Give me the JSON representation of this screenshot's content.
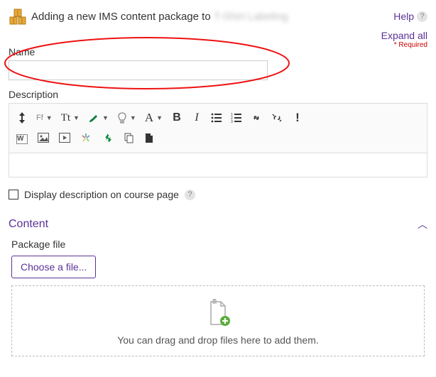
{
  "header": {
    "title_prefix": "Adding a new IMS content package to ",
    "title_course": "T-Shirt Labeling",
    "help_label": "Help",
    "expand_label": "Expand all",
    "required_label": "* Required"
  },
  "general": {
    "name_label": "Name",
    "name_value": "",
    "description_label": "Description",
    "display_desc_label": "Display description on course page"
  },
  "editor": {
    "btn_expand": "expand",
    "btn_font_family": "Ff",
    "btn_font_size": "Tt",
    "btn_brush_color": "brush",
    "btn_highlight": "bulb",
    "btn_text_color": "A",
    "btn_bold": "B",
    "btn_italic": "I",
    "btn_ul": "bulleted-list",
    "btn_ol": "numbered-list",
    "btn_link": "link",
    "btn_unlink": "unlink",
    "btn_info": "info",
    "btn_word": "W",
    "btn_image": "image",
    "btn_media": "media",
    "btn_sparkle": "accessibility-check",
    "btn_recycle": "recycle",
    "btn_copy": "copy",
    "btn_paste": "paste"
  },
  "content": {
    "section_label": "Content",
    "package_file_label": "Package file",
    "choose_file_label": "Choose a file...",
    "dropzone_text": "You can drag and drop files here to add them."
  }
}
